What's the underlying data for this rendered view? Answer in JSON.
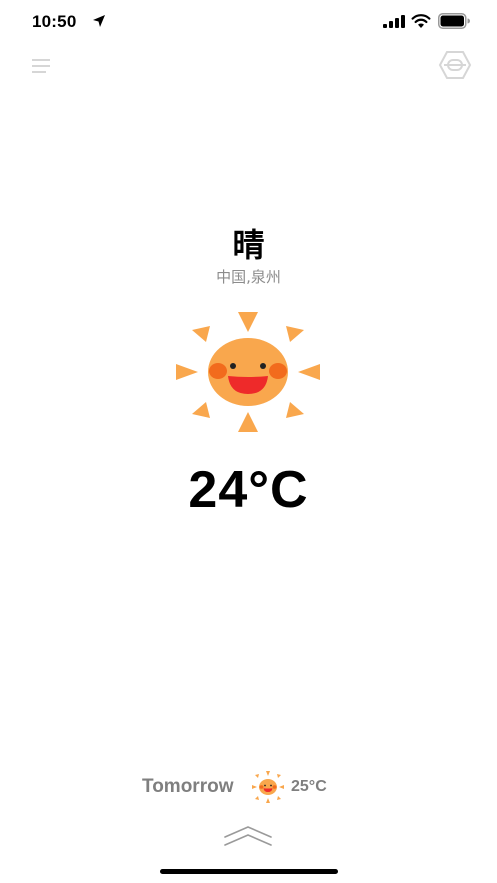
{
  "status_bar": {
    "time": "10:50",
    "icons": [
      "location-arrow-icon",
      "cellular-signal-icon",
      "wifi-icon",
      "battery-icon"
    ]
  },
  "header": {
    "menu_icon": "hamburger-menu-icon",
    "settings_icon": "hexagon-settings-icon"
  },
  "weather": {
    "condition": "晴",
    "location": "中国,泉州",
    "icon": "smiling-sun-icon",
    "temperature": "24°C"
  },
  "tomorrow": {
    "label": "Tomorrow",
    "icon": "smiling-sun-icon",
    "temperature": "25°C"
  },
  "footer": {
    "expand_icon": "double-chevron-up-icon"
  },
  "colors": {
    "sun_face": "#f9a74d",
    "sun_rays": "#f9a74d",
    "cheeks": "#f26b1d",
    "mouth": "#ee2a2a",
    "muted_text": "#8c8c8c",
    "header_icons": "#d6d6d6"
  }
}
